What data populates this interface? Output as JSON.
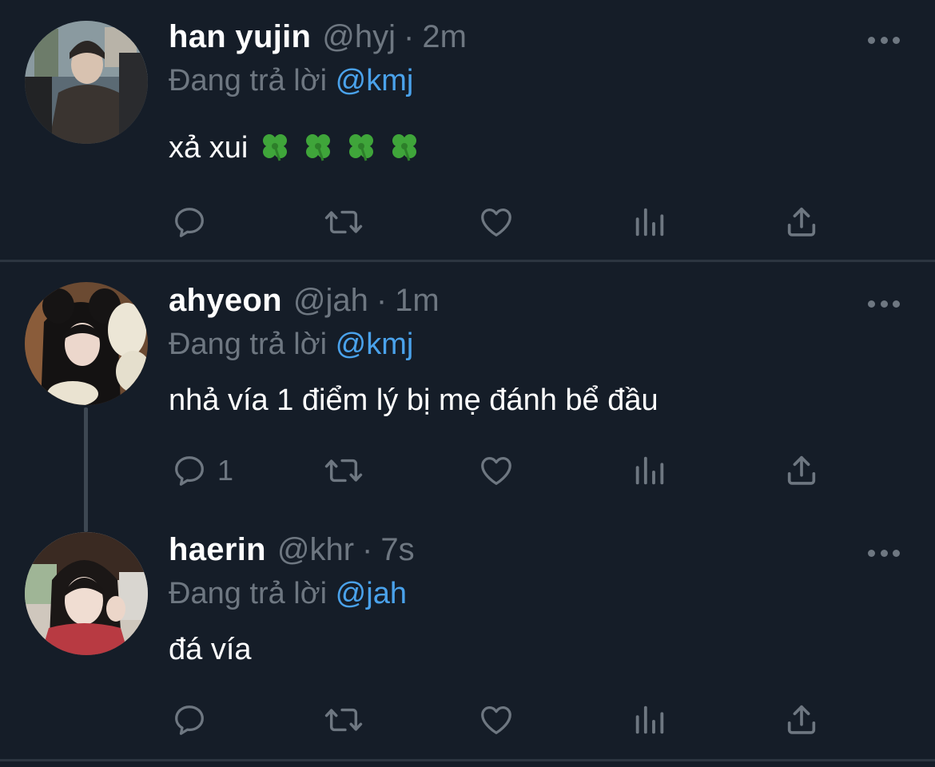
{
  "tweets": [
    {
      "name": "han yujin",
      "handle": "@hyj",
      "separator": "·",
      "time": "2m",
      "reply_prefix": "Đang trả lời",
      "reply_mention": "@kmj",
      "text": "xả xui",
      "emoji": [
        "four-leaf-clover",
        "four-leaf-clover",
        "four-leaf-clover",
        "four-leaf-clover"
      ],
      "reply_count": ""
    },
    {
      "name": "ahyeon",
      "handle": "@jah",
      "separator": "·",
      "time": "1m",
      "reply_prefix": "Đang trả lời",
      "reply_mention": "@kmj",
      "text": "nhả vía 1 điểm lý bị mẹ đánh bể đầu",
      "reply_count": "1"
    },
    {
      "name": "haerin",
      "handle": "@khr",
      "separator": "·",
      "time": "7s",
      "reply_prefix": "Đang trả lời",
      "reply_mention": "@jah",
      "text": "đá vía",
      "reply_count": ""
    }
  ],
  "icons": {
    "more": "more-icon",
    "reply": "reply-icon",
    "retweet": "retweet-icon",
    "like": "like-icon",
    "analytics": "analytics-icon",
    "share": "share-icon"
  },
  "colors": {
    "background": "#151d28",
    "text": "#ffffff",
    "secondary": "#6e7781",
    "mention": "#4aa2eb",
    "divider": "#2c3540",
    "clover": "#3fa53a"
  }
}
